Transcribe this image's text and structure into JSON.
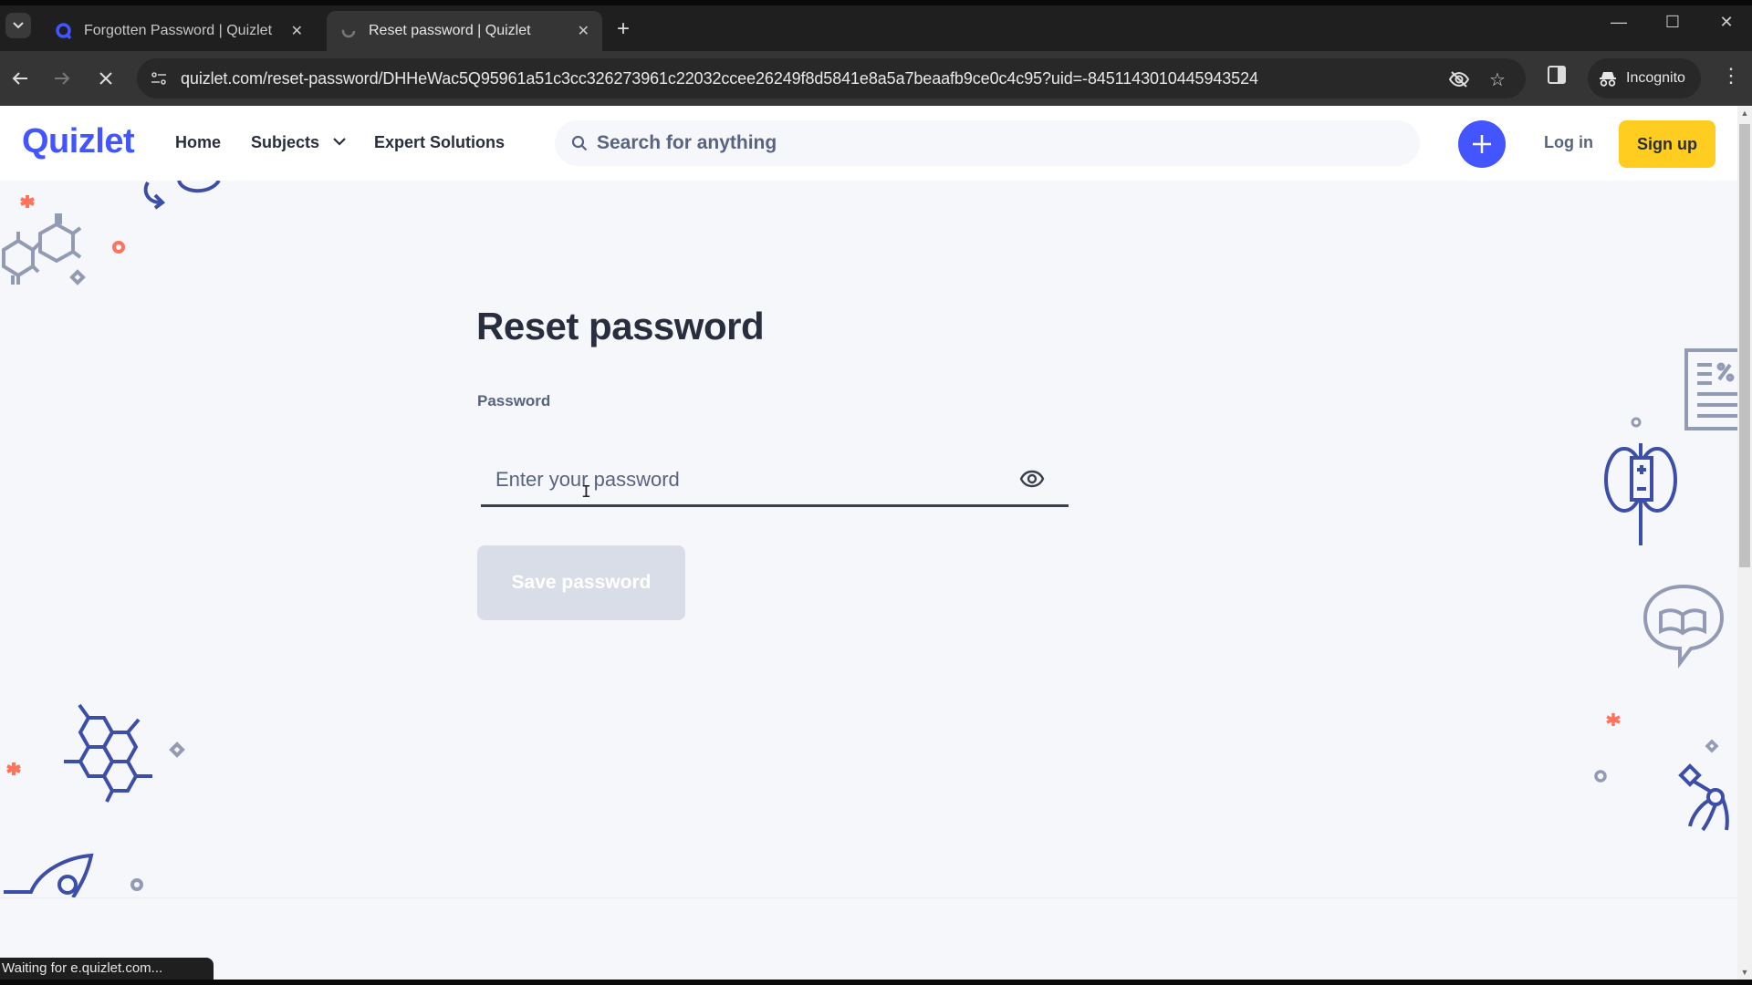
{
  "browser": {
    "tabs": [
      {
        "title": "Forgotten Password | Quizlet",
        "active": false,
        "favicon": "quizlet-q-icon"
      },
      {
        "title": "Reset password | Quizlet",
        "active": true,
        "favicon": "loading-spinner-icon"
      }
    ],
    "new_tab_label": "+",
    "url": "quizlet.com/reset-password/DHHeWac5Q95961a51c3cc326273961c22032ccee26249f8d5841e8a5a7beaafb9ce0c4c95?uid=-8451143010445943524",
    "incognito_label": "Incognito",
    "status_text": "Waiting for e.quizlet.com...",
    "scroll_position_fraction": 0.0,
    "scroll_visible_fraction": 0.52
  },
  "header": {
    "logo": "Quizlet",
    "nav": {
      "home": "Home",
      "subjects": "Subjects",
      "expert_solutions": "Expert Solutions"
    },
    "search_placeholder": "Search for anything",
    "login": "Log in",
    "signup": "Sign up"
  },
  "form": {
    "title": "Reset password",
    "password_label": "Password",
    "password_placeholder": "Enter your password",
    "password_value": "",
    "save_button": "Save password",
    "save_disabled": true
  },
  "colors": {
    "brand": "#4255ff",
    "signup_yellow": "#ffcd1f",
    "page_bg": "#f6f7fb",
    "text_dark": "#282e3e",
    "text_muted": "#586380",
    "accent_red": "#ff725b",
    "deco_gray": "#939bb4"
  }
}
